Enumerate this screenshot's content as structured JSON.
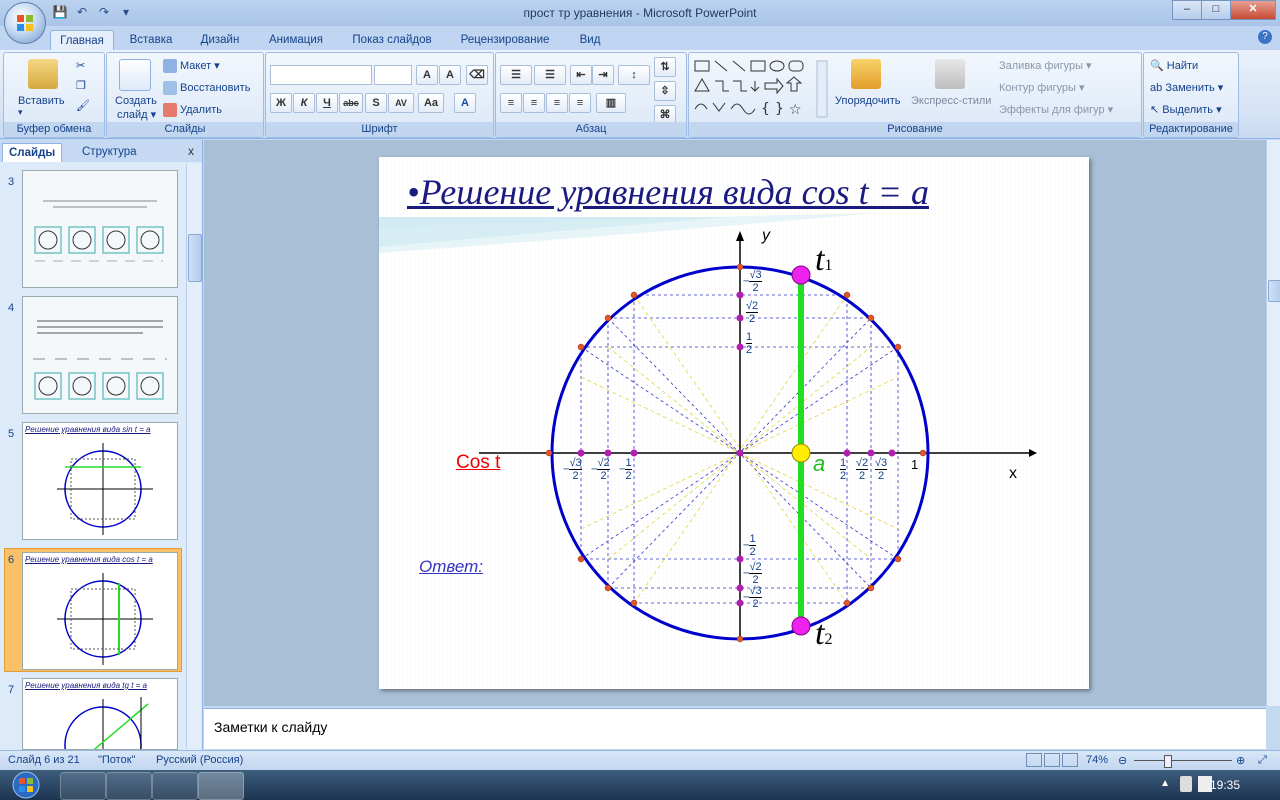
{
  "window": {
    "title": "прост тр уравнения - Microsoft PowerPoint",
    "minimize": "–",
    "maximize": "□",
    "close": "✕"
  },
  "ribbon_tabs": [
    "Главная",
    "Вставка",
    "Дизайн",
    "Анимация",
    "Показ слайдов",
    "Рецензирование",
    "Вид"
  ],
  "clipboard": {
    "paste": "Вставить",
    "group_label": "Буфер обмена"
  },
  "slides_group": {
    "new_slide_1": "Создать",
    "new_slide_2": "слайд ▾",
    "layout": "Макет ▾",
    "reset": "Восстановить",
    "delete": "Удалить",
    "group_label": "Слайды"
  },
  "font_group": {
    "font_name": "",
    "font_size": "",
    "bold": "Ж",
    "italic": "К",
    "underline": "Ч",
    "strike": "abc",
    "shadow": "S",
    "spacing": "AV",
    "case": "Aa",
    "group_label": "Шрифт"
  },
  "paragraph_group": {
    "group_label": "Абзац"
  },
  "drawing_group": {
    "arrange": "Упорядочить",
    "quick_styles": "Экспресс-стили",
    "fill": "Заливка фигуры ▾",
    "outline": "Контур фигуры ▾",
    "effects": "Эффекты для фигур ▾",
    "group_label": "Рисование"
  },
  "editing_group": {
    "find": "Найти",
    "replace": "Заменить ▾",
    "select": "Выделить ▾",
    "group_label": "Редактирование"
  },
  "panel": {
    "tab_slides": "Слайды",
    "tab_outline": "Структура",
    "close": "x",
    "thumbnails": [
      {
        "number": "3",
        "title": ""
      },
      {
        "number": "4",
        "title": ""
      },
      {
        "number": "5",
        "title": "Решение уравнения вида sin t = a"
      },
      {
        "number": "6",
        "title": "Решение уравнения вида cos t = a"
      },
      {
        "number": "7",
        "title": "Решение уравнения вида tg t = a"
      }
    ]
  },
  "slide": {
    "title": "•Решение уравнения вида cos t = a",
    "answer": "Ответ:",
    "cos_label": "Cos t",
    "axis_x": "x",
    "axis_y": "y",
    "label_a": "a",
    "t1": "t",
    "t1_sub": "1",
    "t2": "t",
    "t2_sub": "2",
    "one": "1",
    "tick_half": "1",
    "tick_two": "2",
    "tick_sqrt2": "√2",
    "tick_sqrt3": "√3",
    "minus": "−"
  },
  "notes": "Заметки к слайду",
  "statusbar": {
    "slide_info": "Слайд 6 из 21",
    "theme": "\"Поток\"",
    "language": "Русский (Россия)",
    "zoom": "74%"
  },
  "taskbar": {
    "time": "19:35"
  },
  "colors": {
    "circle": "#0000cc",
    "solution_line": "#22dd22",
    "point_t": "#ee22ee",
    "point_a": "#ffee00",
    "title": "#1a1a80",
    "cos_label": "#ee0000"
  }
}
